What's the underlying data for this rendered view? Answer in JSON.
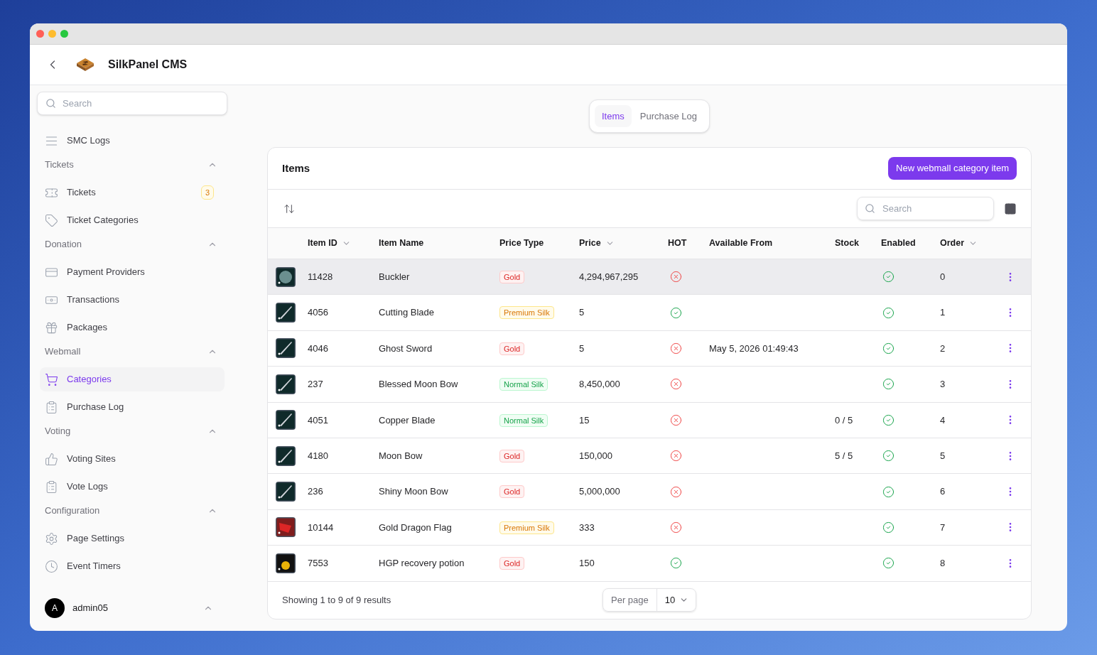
{
  "app": {
    "title": "SilkPanel CMS"
  },
  "sidebar": {
    "search": {
      "placeholder": "Search"
    },
    "top_items": [
      {
        "label": "SMC Logs",
        "selected": false
      }
    ],
    "sections": [
      {
        "title": "Tickets",
        "expanded": true,
        "items": [
          {
            "label": "Tickets",
            "badge": "3",
            "selected": false
          },
          {
            "label": "Ticket Categories",
            "selected": false
          }
        ]
      },
      {
        "title": "Donation",
        "expanded": true,
        "items": [
          {
            "label": "Payment Providers",
            "selected": false
          },
          {
            "label": "Transactions",
            "selected": false
          },
          {
            "label": "Packages",
            "selected": false
          }
        ]
      },
      {
        "title": "Webmall",
        "expanded": true,
        "items": [
          {
            "label": "Categories",
            "selected": true
          },
          {
            "label": "Purchase Log",
            "selected": false
          }
        ]
      },
      {
        "title": "Voting",
        "expanded": true,
        "items": [
          {
            "label": "Voting Sites",
            "selected": false
          },
          {
            "label": "Vote Logs",
            "selected": false
          }
        ]
      },
      {
        "title": "Configuration",
        "expanded": true,
        "items": [
          {
            "label": "Page Settings",
            "selected": false
          },
          {
            "label": "Event Timers",
            "selected": false
          }
        ]
      }
    ],
    "user": {
      "initial": "A",
      "name": "admin05"
    }
  },
  "tabs": [
    {
      "label": "Items",
      "selected": true
    },
    {
      "label": "Purchase Log",
      "selected": false
    }
  ],
  "card": {
    "title": "Items",
    "new_button": "New webmall category item",
    "search": {
      "placeholder": "Search"
    },
    "columns": [
      {
        "label": "Item ID",
        "sortable": true
      },
      {
        "label": "Item Name",
        "sortable": false
      },
      {
        "label": "Price Type",
        "sortable": false
      },
      {
        "label": "Price",
        "sortable": true
      },
      {
        "label": "HOT",
        "sortable": false
      },
      {
        "label": "Available From",
        "sortable": false
      },
      {
        "label": "Stock",
        "sortable": false
      },
      {
        "label": "Enabled",
        "sortable": false
      },
      {
        "label": "Order",
        "sortable": true
      }
    ],
    "rows": [
      {
        "hovered": true,
        "id": "11428",
        "name": "Buckler",
        "price_type": {
          "label": "Gold",
          "kind": "gold"
        },
        "price": "4,294,967,295",
        "hot": false,
        "available_from": "",
        "stock": "",
        "enabled": true,
        "order": "0"
      },
      {
        "hovered": false,
        "id": "4056",
        "name": "Cutting Blade",
        "price_type": {
          "label": "Premium Silk",
          "kind": "premium"
        },
        "price": "5",
        "hot": true,
        "available_from": "",
        "stock": "",
        "enabled": true,
        "order": "1"
      },
      {
        "hovered": false,
        "id": "4046",
        "name": "Ghost Sword",
        "price_type": {
          "label": "Gold",
          "kind": "gold"
        },
        "price": "5",
        "hot": false,
        "available_from": "May 5, 2026 01:49:43",
        "stock": "",
        "enabled": true,
        "order": "2"
      },
      {
        "hovered": false,
        "id": "237",
        "name": "Blessed Moon Bow",
        "price_type": {
          "label": "Normal Silk",
          "kind": "normal"
        },
        "price": "8,450,000",
        "hot": false,
        "available_from": "",
        "stock": "",
        "enabled": true,
        "order": "3"
      },
      {
        "hovered": false,
        "id": "4051",
        "name": "Copper Blade",
        "price_type": {
          "label": "Normal Silk",
          "kind": "normal"
        },
        "price": "15",
        "hot": false,
        "available_from": "",
        "stock": "0 / 5",
        "enabled": true,
        "order": "4"
      },
      {
        "hovered": false,
        "id": "4180",
        "name": "Moon Bow",
        "price_type": {
          "label": "Gold",
          "kind": "gold"
        },
        "price": "150,000",
        "hot": false,
        "available_from": "",
        "stock": "5 / 5",
        "enabled": true,
        "order": "5"
      },
      {
        "hovered": false,
        "id": "236",
        "name": "Shiny Moon Bow",
        "price_type": {
          "label": "Gold",
          "kind": "gold"
        },
        "price": "5,000,000",
        "hot": false,
        "available_from": "",
        "stock": "",
        "enabled": true,
        "order": "6"
      },
      {
        "hovered": false,
        "id": "10144",
        "name": "Gold Dragon Flag",
        "price_type": {
          "label": "Premium Silk",
          "kind": "premium"
        },
        "price": "333",
        "hot": false,
        "available_from": "",
        "stock": "",
        "enabled": true,
        "order": "7"
      },
      {
        "hovered": false,
        "id": "7553",
        "name": "HGP recovery potion",
        "price_type": {
          "label": "Gold",
          "kind": "gold"
        },
        "price": "150",
        "hot": true,
        "available_from": "",
        "stock": "",
        "enabled": true,
        "order": "8"
      }
    ],
    "footer": {
      "summary": "Showing 1 to 9 of 9 results",
      "per_page_label": "Per page",
      "per_page_value": "10"
    }
  }
}
